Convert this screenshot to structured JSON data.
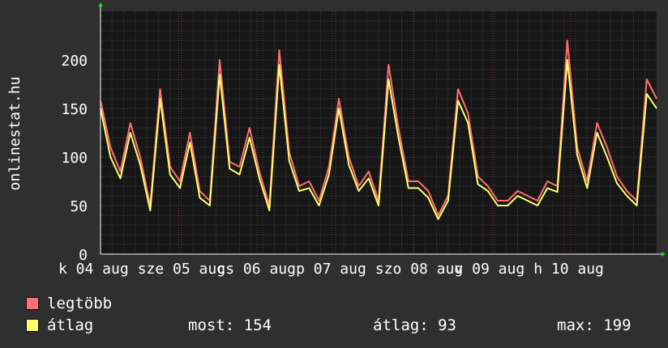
{
  "colors": {
    "background": "#2f2f2f",
    "plot_background": "#161616",
    "grid": "#444444",
    "major_grid": "#7a3a3a",
    "max_series": "#ff7070",
    "avg_series": "#ffff70",
    "axis": "#ffffff"
  },
  "side_label": "onlinestat.hu",
  "legend": {
    "items": [
      {
        "label": "legtöbb",
        "color": "#ff7070"
      },
      {
        "label": "átlag",
        "color": "#ffff70"
      }
    ],
    "stats": {
      "now": "most: 154",
      "avg": "átlag: 93",
      "max": "max: 199"
    }
  },
  "chart_data": {
    "type": "line",
    "title": "",
    "ylabel": "onlinestat.hu",
    "ylim": [
      0,
      250
    ],
    "yticks": [
      0,
      50,
      100,
      150,
      200
    ],
    "grid": true,
    "legend_position": "bottom-left",
    "x_tick_labels": [
      "k 04 aug",
      "sze 05 aug",
      "cs 06 aug",
      "p 07 aug",
      "szo 08 aug",
      "v 09 aug",
      "h 10 aug"
    ],
    "x": [
      0,
      3,
      6,
      9,
      12,
      15,
      18,
      21,
      24,
      27,
      30,
      33,
      36,
      39,
      42,
      45,
      48,
      51,
      54,
      57,
      60,
      63,
      66,
      69,
      72,
      75,
      78,
      81,
      84,
      87,
      90,
      93,
      96,
      99,
      102,
      105,
      108,
      111,
      114,
      117,
      120,
      123,
      126,
      129,
      132,
      135,
      138,
      141,
      144,
      147,
      150,
      153,
      156,
      159,
      162,
      165,
      168
    ],
    "series": [
      {
        "name": "legtöbb",
        "values": [
          158,
          110,
          85,
          135,
          100,
          50,
          170,
          90,
          75,
          125,
          65,
          55,
          200,
          95,
          90,
          130,
          85,
          50,
          210,
          105,
          70,
          75,
          55,
          90,
          160,
          100,
          70,
          85,
          55,
          195,
          130,
          75,
          75,
          65,
          40,
          60,
          170,
          145,
          80,
          70,
          55,
          55,
          65,
          60,
          55,
          75,
          70,
          220,
          110,
          75,
          135,
          110,
          80,
          65,
          55,
          180,
          160
        ]
      },
      {
        "name": "átlag",
        "values": [
          150,
          100,
          78,
          125,
          92,
          45,
          160,
          82,
          68,
          115,
          58,
          50,
          185,
          88,
          82,
          120,
          78,
          45,
          195,
          96,
          65,
          68,
          50,
          82,
          150,
          92,
          65,
          78,
          50,
          180,
          120,
          68,
          68,
          58,
          36,
          55,
          158,
          135,
          72,
          65,
          50,
          50,
          60,
          55,
          50,
          68,
          64,
          200,
          102,
          68,
          125,
          100,
          73,
          60,
          50,
          165,
          150
        ]
      }
    ]
  }
}
